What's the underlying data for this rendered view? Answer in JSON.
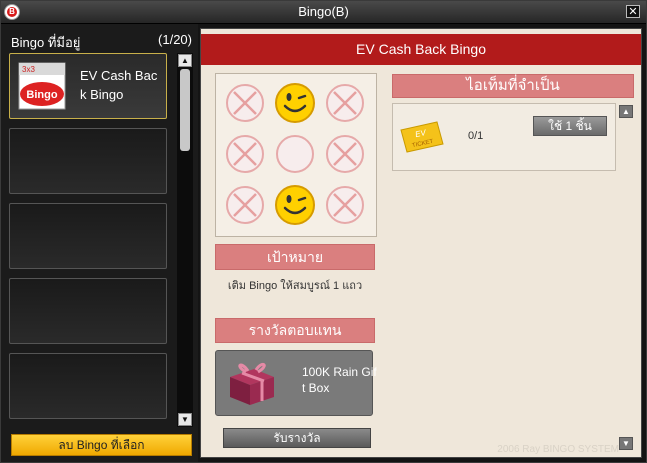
{
  "window": {
    "title": "Bingo(B)",
    "close_label": "✕"
  },
  "left": {
    "title": "Bingo ที่มีอยู่",
    "count": "(1/20)",
    "slots": [
      {
        "label": "EV Cash Bac\nk Bingo",
        "selected": true
      },
      {
        "label": ""
      },
      {
        "label": ""
      },
      {
        "label": ""
      },
      {
        "label": ""
      }
    ],
    "delete_button": "ลบ Bingo  ที่เลือก"
  },
  "right": {
    "header": "EV Cash Back Bingo",
    "board": [
      "x",
      "smiley",
      "x",
      "x",
      "empty",
      "x",
      "x",
      "smiley",
      "x"
    ],
    "goal_title": "เป้าหมาย",
    "goal_text": "เติม Bingo ให้สมบูรณ์ 1 แถว",
    "reward_title": "รางวัลตอบแทน",
    "reward_item": "100K Rain Gif\nt Box",
    "claim_button": "รับรางวัล",
    "required_title": "ไอเท็มที่จำเป็น",
    "required_items": [
      {
        "name": "EV TICKET",
        "count": "0/1",
        "use_label": "ใช้ 1 ชิ้น"
      }
    ],
    "copyright": "2006 Ray BINGO SYSTEM"
  },
  "colors": {
    "header_red": "#b21b1b",
    "pink_bar": "#da7f7f",
    "yellow_button": "#f0a800",
    "selected_slot_border": "#c8b04a"
  }
}
